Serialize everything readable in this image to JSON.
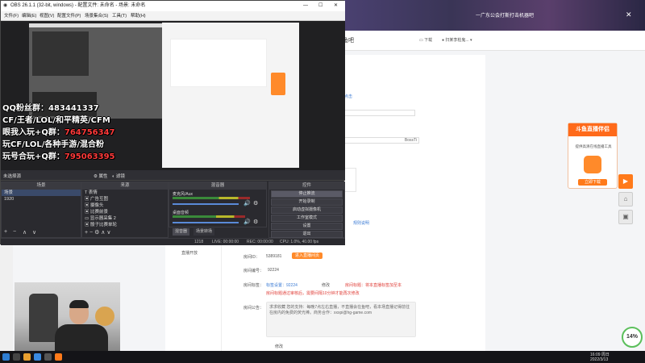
{
  "obs": {
    "title": "OBS 26.1.1 (32-bit, windows) - 配置文件: 未命名 - 场景: 未命名",
    "menu": [
      "文件(F)",
      "编辑(E)",
      "视图(V)",
      "配置文件(P)",
      "场景集合(S)",
      "工具(T)",
      "帮助(H)"
    ],
    "overlay_lines": [
      {
        "text": "QQ粉丝群：483441337",
        "red": false
      },
      {
        "text": "CF/王者/LOL/和平精英/CFM",
        "red": false
      },
      {
        "text": "眼我入玩+Q群：",
        "red": false,
        "tail": "764756347"
      },
      {
        "text": "玩CF/LOL/各种手游/混合粉",
        "red": false
      },
      {
        "text": "玩号合玩+Q群：",
        "red": false,
        "tail": "795063395"
      }
    ],
    "scene_bar": {
      "label": "未选择源",
      "props": "属性",
      "filters": "滤镜"
    },
    "docks": {
      "scenes": {
        "title": "场景",
        "items": [
          "场景",
          "1920"
        ]
      },
      "sources": {
        "title": "来源",
        "items": [
          "表情",
          "广告互图",
          "摄像头",
          "比赛前景",
          "显示器采集 2",
          "骰子比赛单轮"
        ]
      },
      "mixer": {
        "title": "混音器",
        "ch1": "麦克风/Aux",
        "ch2": "桌面音频"
      },
      "controls": {
        "title": "控件",
        "buttons": [
          "停止推流",
          "开始录制",
          "启动虚拟摄像机",
          "工作室模式",
          "设置",
          "退出"
        ]
      }
    },
    "tabs": [
      "混音器",
      "场景转场"
    ],
    "status": {
      "live": "LIVE: 00:00:00",
      "rec": "REC: 00:00:00",
      "cpu": "CPU: 1.0%, 40.00 fps",
      "kb": "1218"
    }
  },
  "browser": {
    "header_text": "一广东公会打斯打击机器吧",
    "sec_title": "鱼吧",
    "download": "下载",
    "user": "扫某李柏鬼...",
    "link_top": "点击",
    "field_value": "BossTi",
    "link_mid": "规则说明",
    "sidebar_item": "直播开放",
    "room_id_label": "房间ID：",
    "room_id": "5389181",
    "room_id_btn": "进入直播间页",
    "room_num_label": "房间编号：",
    "room_num": "92224",
    "room_tag_label": "房间标签：",
    "room_tag_link": "标签设置：92224",
    "room_tag_edit": "修改",
    "room_tag_red": "房间标题：将本直播标签加至本",
    "room_tag_red2": "房间标题通过审核后，需要间隔10分钟才能再次修改",
    "notice_label": "房间公告：",
    "notice_text": "求求收藏 您的支持：每晚7点左右直播，不直播会在鱼吧，看本场直播记得前往在房内的免费的荧光棒。商务合作：xxxpi@hg-game.com",
    "edit": "修改",
    "ad_title": "斗鱼直播伴侣",
    "ad_sub": "提供高清在线直播工具",
    "ad_btn": "立即下载",
    "ring": "14%",
    "ring_sub": "0.5K/s"
  },
  "taskbar": {
    "time": "16:09 周日",
    "date": "2022/3/13"
  },
  "colors": {
    "accent": "#ff7a1a",
    "link": "#3b7bd4",
    "danger": "#e0403a"
  }
}
